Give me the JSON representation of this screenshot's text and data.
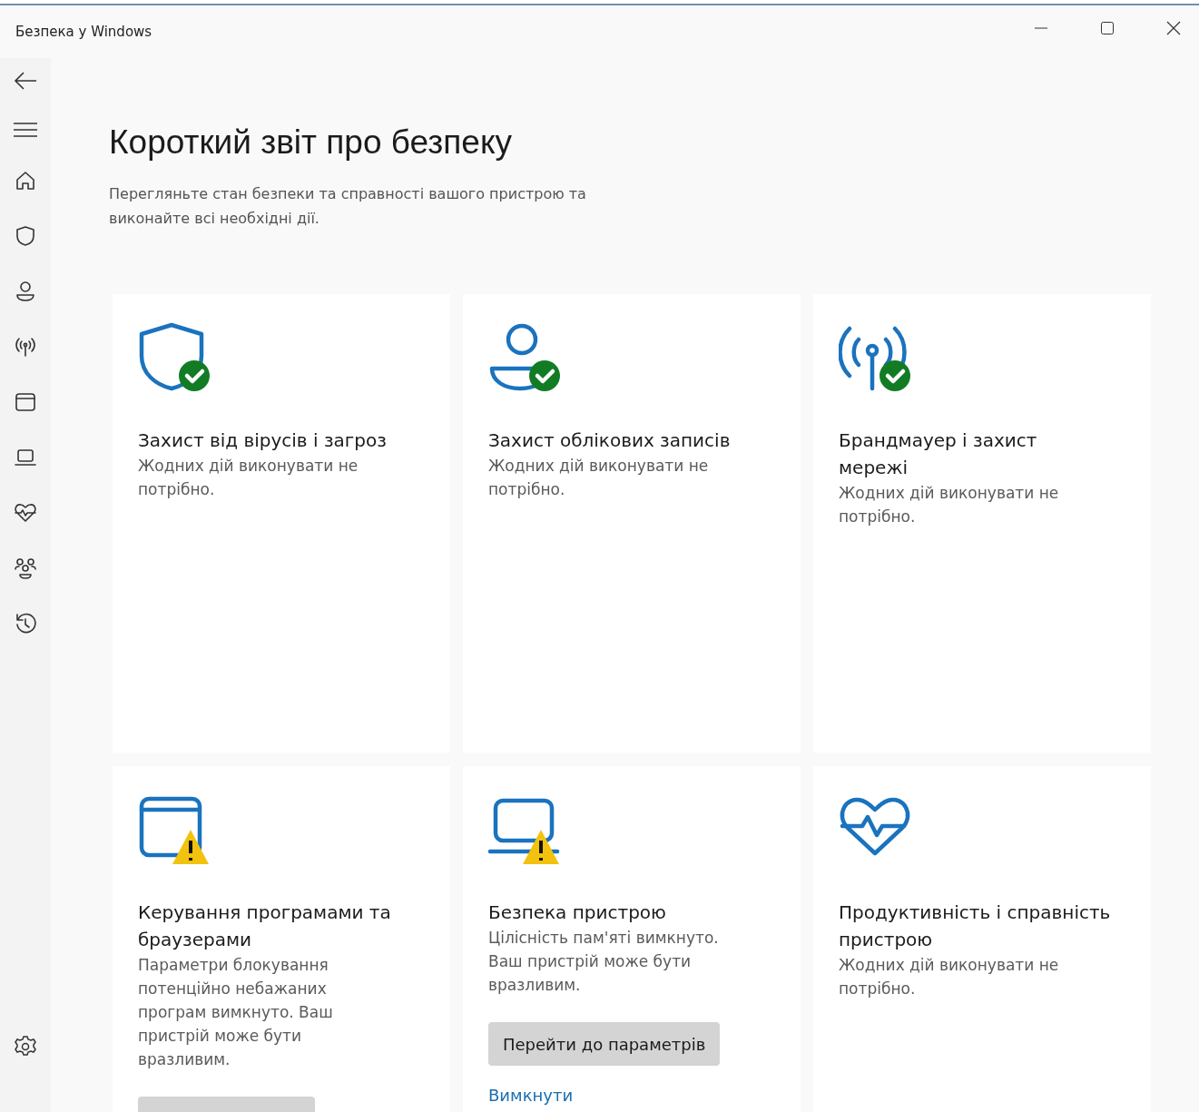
{
  "window": {
    "title": "Безпека у Windows"
  },
  "page": {
    "title": "Короткий звіт про безпеку",
    "subtitle": "Перегляньте стан безпеки та справності вашого пристрою та виконайте всі необхідні дії."
  },
  "cards": [
    {
      "title": "Захист від вірусів і загроз",
      "checked": true,
      "warning": false,
      "description": "Жодних дій виконувати не потрібно."
    },
    {
      "title": "Захист облікових записів",
      "checked": true,
      "warning": false,
      "description": "Жодних дій виконувати не потрібно."
    },
    {
      "title": "Брандмауер і захист мережі",
      "checked": true,
      "warning": false,
      "description": "Жодних дій виконувати не потрібно."
    },
    {
      "title": "Керування програмами та браузерами",
      "checked": false,
      "warning": true,
      "description": "Параметри блокування потенційно небажаних програм вимкнуто. Ваш пристрій може бути вразливим.",
      "actions": [
        {
          "kind": "button"
        }
      ]
    },
    {
      "title": "Безпека пристрою",
      "checked": false,
      "warning": true,
      "description": "Цілісність пам'яті вимкнуто. Ваш пристрій може бути вразливим.",
      "actions": [
        {
          "kind": "button",
          "label": "Перейти до параметрів"
        },
        {
          "kind": "link",
          "label": "Вимкнути"
        }
      ]
    },
    {
      "title": "Продуктивність і справність пристрою",
      "checked": false,
      "warning": false,
      "description": "Жодних дій виконувати не потрібно."
    }
  ]
}
